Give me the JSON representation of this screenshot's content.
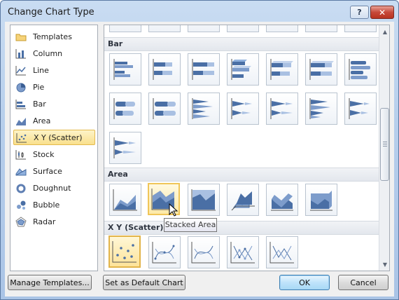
{
  "window": {
    "title": "Change Chart Type",
    "help_label": "?",
    "close_label": "✕"
  },
  "categories": [
    {
      "label": "Templates",
      "icon": "folder-icon"
    },
    {
      "label": "Column",
      "icon": "column-chart-icon"
    },
    {
      "label": "Line",
      "icon": "line-chart-icon"
    },
    {
      "label": "Pie",
      "icon": "pie-chart-icon"
    },
    {
      "label": "Bar",
      "icon": "bar-chart-icon"
    },
    {
      "label": "Area",
      "icon": "area-chart-icon"
    },
    {
      "label": "X Y (Scatter)",
      "icon": "scatter-chart-icon",
      "selected": true
    },
    {
      "label": "Stock",
      "icon": "stock-chart-icon"
    },
    {
      "label": "Surface",
      "icon": "surface-chart-icon"
    },
    {
      "label": "Doughnut",
      "icon": "doughnut-chart-icon"
    },
    {
      "label": "Bubble",
      "icon": "bubble-chart-icon"
    },
    {
      "label": "Radar",
      "icon": "radar-chart-icon"
    }
  ],
  "gallery": {
    "sections": {
      "bar": "Bar",
      "area": "Area",
      "scatter": "X Y (Scatter)"
    },
    "tooltip": "Stacked Area"
  },
  "buttons": {
    "manage_templates": "Manage Templates...",
    "set_default": "Set as Default Chart",
    "ok": "OK",
    "cancel": "Cancel"
  },
  "colors": {
    "accent_blue": "#4a6fa5",
    "selection_gold": "#e4b94c"
  }
}
